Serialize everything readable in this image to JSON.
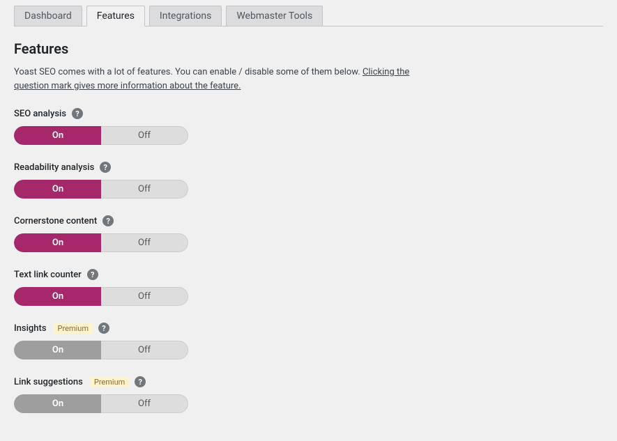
{
  "tabs": [
    {
      "label": "Dashboard",
      "active": false
    },
    {
      "label": "Features",
      "active": true
    },
    {
      "label": "Integrations",
      "active": false
    },
    {
      "label": "Webmaster Tools",
      "active": false
    }
  ],
  "section": {
    "title": "Features",
    "desc_part1": "Yoast SEO comes with a lot of features. You can enable / disable some of them below. ",
    "desc_link": "Clicking the question mark gives more information about the feature."
  },
  "toggle_labels": {
    "on": "On",
    "off": "Off"
  },
  "badges": {
    "premium": "Premium"
  },
  "features": [
    {
      "label": "SEO analysis",
      "premium": false,
      "state": "on",
      "enabled": true
    },
    {
      "label": "Readability analysis",
      "premium": false,
      "state": "on",
      "enabled": true
    },
    {
      "label": "Cornerstone content",
      "premium": false,
      "state": "on",
      "enabled": true
    },
    {
      "label": "Text link counter",
      "premium": false,
      "state": "on",
      "enabled": true
    },
    {
      "label": "Insights",
      "premium": true,
      "state": "on",
      "enabled": false
    },
    {
      "label": "Link suggestions",
      "premium": true,
      "state": "on",
      "enabled": false
    }
  ],
  "colors": {
    "accent": "#a4286a",
    "disabled": "#9e9e9e",
    "premium_bg": "#fff3cd"
  }
}
